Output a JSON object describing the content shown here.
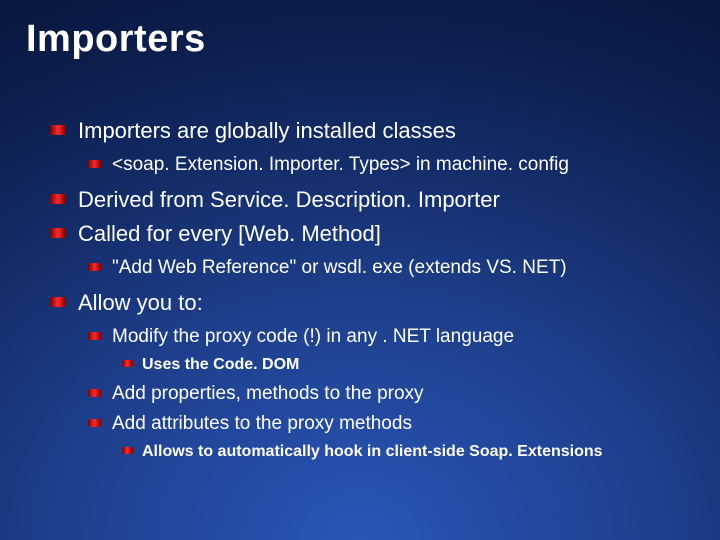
{
  "title": "Importers",
  "bullets": [
    {
      "text": "Importers are globally installed classes",
      "children": [
        {
          "text": "<soap. Extension. Importer. Types> in machine. config"
        }
      ]
    },
    {
      "text": "Derived from Service. Description. Importer"
    },
    {
      "text": "Called for every [Web. Method]",
      "children": [
        {
          "text": "\"Add Web Reference\" or wsdl. exe (extends VS. NET)"
        }
      ]
    },
    {
      "text": "Allow you to:",
      "children": [
        {
          "text": "Modify the proxy code (!) in any . NET language",
          "children": [
            {
              "text": "Uses the Code. DOM"
            }
          ]
        },
        {
          "text": "Add properties, methods to the proxy"
        },
        {
          "text": "Add attributes to the proxy methods",
          "children": [
            {
              "text": "Allows to automatically hook in client-side Soap. Extensions"
            }
          ]
        }
      ]
    }
  ]
}
